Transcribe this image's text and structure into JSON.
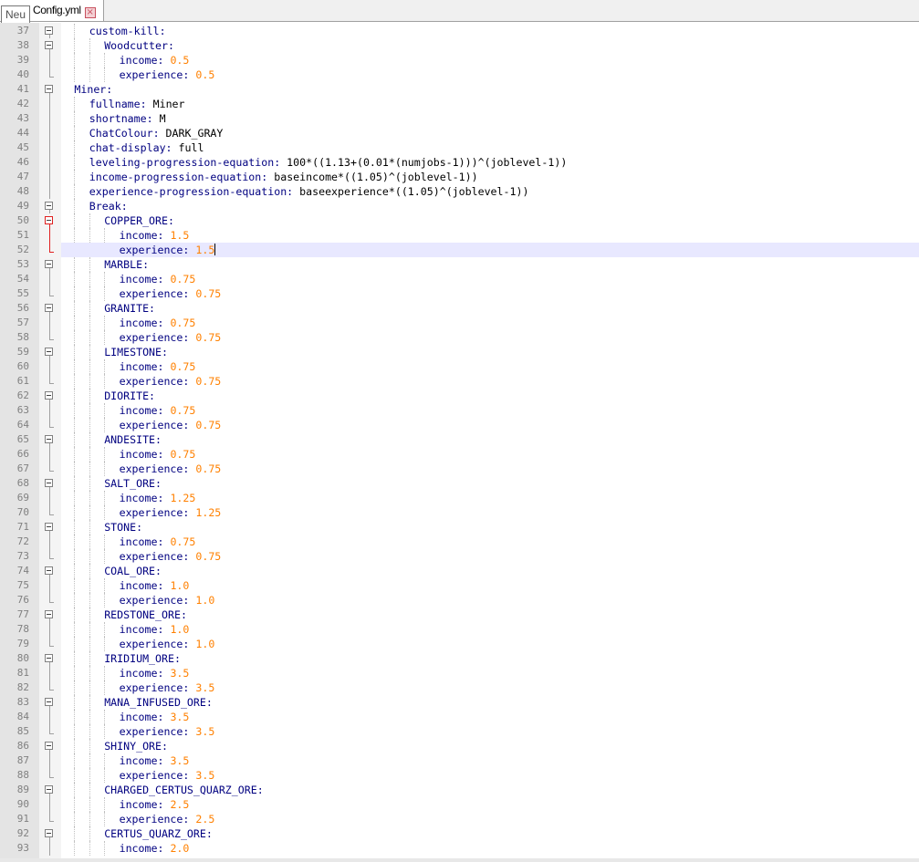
{
  "tab": {
    "title": "Config.yml",
    "close_glyph": "×"
  },
  "tooltip": "Neu",
  "editor": {
    "current_line": 52,
    "lines": [
      {
        "n": "37",
        "indent": 2,
        "key": "custom-kill",
        "fold": "box"
      },
      {
        "n": "38",
        "indent": 3,
        "key": "Woodcutter",
        "fold": "box"
      },
      {
        "n": "39",
        "indent": 4,
        "key": "income",
        "num": "0.5",
        "fold": "bar"
      },
      {
        "n": "40",
        "indent": 4,
        "key": "experience",
        "num": "0.5",
        "fold": "end"
      },
      {
        "n": "41",
        "indent": 1,
        "key": "Miner",
        "fold": "box"
      },
      {
        "n": "42",
        "indent": 2,
        "key": "fullname",
        "val": "Miner",
        "fold": "bar"
      },
      {
        "n": "43",
        "indent": 2,
        "key": "shortname",
        "val": "M",
        "fold": "bar"
      },
      {
        "n": "44",
        "indent": 2,
        "key": "ChatColour",
        "val": "DARK_GRAY",
        "fold": "bar"
      },
      {
        "n": "45",
        "indent": 2,
        "key": "chat-display",
        "val": "full",
        "fold": "bar"
      },
      {
        "n": "46",
        "indent": 2,
        "key": "leveling-progression-equation",
        "val": "100*((1.13+(0.01*(numjobs-1)))^(joblevel-1))",
        "fold": "bar"
      },
      {
        "n": "47",
        "indent": 2,
        "key": "income-progression-equation",
        "val": "baseincome*((1.05)^(joblevel-1))",
        "fold": "bar"
      },
      {
        "n": "48",
        "indent": 2,
        "key": "experience-progression-equation",
        "val": "baseexperience*((1.05)^(joblevel-1))",
        "fold": "bar"
      },
      {
        "n": "49",
        "indent": 2,
        "key": "Break",
        "fold": "box"
      },
      {
        "n": "50",
        "indent": 3,
        "key": "COPPER_ORE",
        "fold": "boxred"
      },
      {
        "n": "51",
        "indent": 4,
        "key": "income",
        "num": "1.5",
        "fold": "barred"
      },
      {
        "n": "52",
        "indent": 4,
        "key": "experience",
        "num": "1.5",
        "fold": "endred"
      },
      {
        "n": "53",
        "indent": 3,
        "key": "MARBLE",
        "fold": "box"
      },
      {
        "n": "54",
        "indent": 4,
        "key": "income",
        "num": "0.75",
        "fold": "bar"
      },
      {
        "n": "55",
        "indent": 4,
        "key": "experience",
        "num": "0.75",
        "fold": "end"
      },
      {
        "n": "56",
        "indent": 3,
        "key": "GRANITE",
        "fold": "box"
      },
      {
        "n": "57",
        "indent": 4,
        "key": "income",
        "num": "0.75",
        "fold": "bar"
      },
      {
        "n": "58",
        "indent": 4,
        "key": "experience",
        "num": "0.75",
        "fold": "end"
      },
      {
        "n": "59",
        "indent": 3,
        "key": "LIMESTONE",
        "fold": "box"
      },
      {
        "n": "60",
        "indent": 4,
        "key": "income",
        "num": "0.75",
        "fold": "bar"
      },
      {
        "n": "61",
        "indent": 4,
        "key": "experience",
        "num": "0.75",
        "fold": "end"
      },
      {
        "n": "62",
        "indent": 3,
        "key": "DIORITE",
        "fold": "box"
      },
      {
        "n": "63",
        "indent": 4,
        "key": "income",
        "num": "0.75",
        "fold": "bar"
      },
      {
        "n": "64",
        "indent": 4,
        "key": "experience",
        "num": "0.75",
        "fold": "end"
      },
      {
        "n": "65",
        "indent": 3,
        "key": "ANDESITE",
        "fold": "box"
      },
      {
        "n": "66",
        "indent": 4,
        "key": "income",
        "num": "0.75",
        "fold": "bar"
      },
      {
        "n": "67",
        "indent": 4,
        "key": "experience",
        "num": "0.75",
        "fold": "end"
      },
      {
        "n": "68",
        "indent": 3,
        "key": "SALT_ORE",
        "fold": "box"
      },
      {
        "n": "69",
        "indent": 4,
        "key": "income",
        "num": "1.25",
        "fold": "bar"
      },
      {
        "n": "70",
        "indent": 4,
        "key": "experience",
        "num": "1.25",
        "fold": "end"
      },
      {
        "n": "71",
        "indent": 3,
        "key": "STONE",
        "fold": "box"
      },
      {
        "n": "72",
        "indent": 4,
        "key": "income",
        "num": "0.75",
        "fold": "bar"
      },
      {
        "n": "73",
        "indent": 4,
        "key": "experience",
        "num": "0.75",
        "fold": "end"
      },
      {
        "n": "74",
        "indent": 3,
        "key": "COAL_ORE",
        "fold": "box"
      },
      {
        "n": "75",
        "indent": 4,
        "key": "income",
        "num": "1.0",
        "fold": "bar"
      },
      {
        "n": "76",
        "indent": 4,
        "key": "experience",
        "num": "1.0",
        "fold": "end"
      },
      {
        "n": "77",
        "indent": 3,
        "key": "REDSTONE_ORE",
        "fold": "box"
      },
      {
        "n": "78",
        "indent": 4,
        "key": "income",
        "num": "1.0",
        "fold": "bar"
      },
      {
        "n": "79",
        "indent": 4,
        "key": "experience",
        "num": "1.0",
        "fold": "end"
      },
      {
        "n": "80",
        "indent": 3,
        "key": "IRIDIUM_ORE",
        "fold": "box"
      },
      {
        "n": "81",
        "indent": 4,
        "key": "income",
        "num": "3.5",
        "fold": "bar"
      },
      {
        "n": "82",
        "indent": 4,
        "key": "experience",
        "num": "3.5",
        "fold": "end"
      },
      {
        "n": "83",
        "indent": 3,
        "key": "MANA_INFUSED_ORE",
        "fold": "box"
      },
      {
        "n": "84",
        "indent": 4,
        "key": "income",
        "num": "3.5",
        "fold": "bar"
      },
      {
        "n": "85",
        "indent": 4,
        "key": "experience",
        "num": "3.5",
        "fold": "end"
      },
      {
        "n": "86",
        "indent": 3,
        "key": "SHINY_ORE",
        "fold": "box"
      },
      {
        "n": "87",
        "indent": 4,
        "key": "income",
        "num": "3.5",
        "fold": "bar"
      },
      {
        "n": "88",
        "indent": 4,
        "key": "experience",
        "num": "3.5",
        "fold": "end"
      },
      {
        "n": "89",
        "indent": 3,
        "key": "CHARGED_CERTUS_QUARZ_ORE",
        "fold": "box"
      },
      {
        "n": "90",
        "indent": 4,
        "key": "income",
        "num": "2.5",
        "fold": "bar"
      },
      {
        "n": "91",
        "indent": 4,
        "key": "experience",
        "num": "2.5",
        "fold": "end"
      },
      {
        "n": "92",
        "indent": 3,
        "key": "CERTUS_QUARZ_ORE",
        "fold": "box"
      },
      {
        "n": "93",
        "indent": 4,
        "key": "income",
        "num": "2.0",
        "fold": "bar"
      }
    ]
  }
}
